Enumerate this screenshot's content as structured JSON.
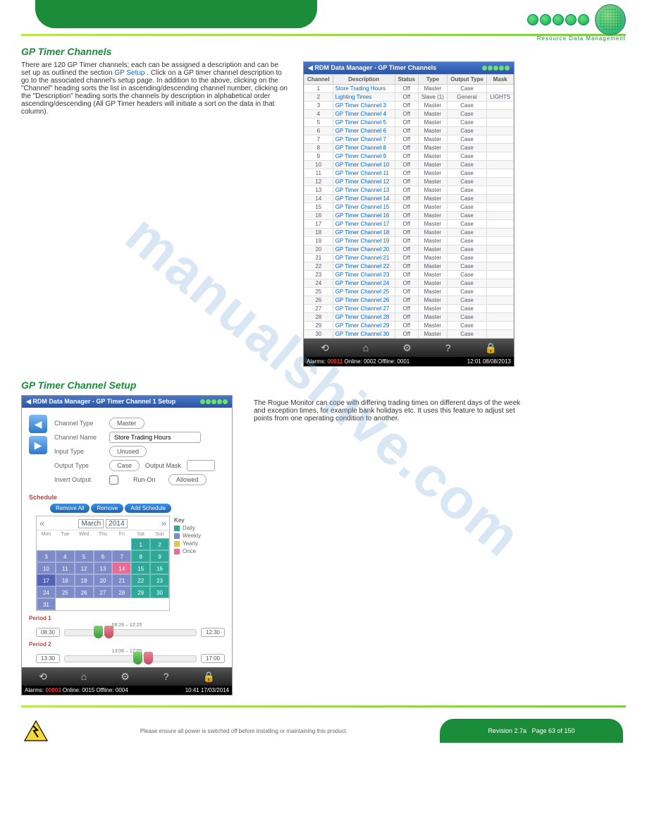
{
  "brand_tagline": "Resource Data Management",
  "section1_title": "GP Timer Channels",
  "section1_text_a": "There are 120 GP Timer channels; each can be assigned a description and can be set up as outlined the section ",
  "section1_link": "GP Setup",
  "section1_text_b": ". Click on a GP timer channel description to go to the associated channel's setup page. In addition to the above, clicking on the \"Channel\" heading sorts the list in ascending/descending channel number, clicking on the \"Description\" heading sorts the channels by description in alphabetical order ascending/descending (All GP Timer headers will initiate a sort on the data in that column).",
  "section2_title": "GP Timer Channel Setup",
  "section2_text": "The Rogue Monitor can cope with differing trading times on different days of the week and exception times, for example bank holidays etc. It uses this feature to adjust set points from one operating condition to another.",
  "table_app_title": "RDM Data Manager - GP Timer Channels",
  "table_headers": {
    "c1": "Channel",
    "c2": "Description",
    "c3": "Status",
    "c4": "Type",
    "c5": "Output Type",
    "c6": "Mask"
  },
  "table_rows": [
    {
      "ch": "1",
      "desc": "Store Trading Hours",
      "status": "Off",
      "type": "Master",
      "otype": "Case",
      "mask": ""
    },
    {
      "ch": "2",
      "desc": "Lighting Times",
      "status": "Off",
      "type": "Slave (1)",
      "otype": "General",
      "mask": "LIGHTS"
    },
    {
      "ch": "3",
      "desc": "GP Timer Channel 3",
      "status": "Off",
      "type": "Master",
      "otype": "Case",
      "mask": ""
    },
    {
      "ch": "4",
      "desc": "GP Timer Channel 4",
      "status": "Off",
      "type": "Master",
      "otype": "Case",
      "mask": ""
    },
    {
      "ch": "5",
      "desc": "GP Timer Channel 5",
      "status": "Off",
      "type": "Master",
      "otype": "Case",
      "mask": ""
    },
    {
      "ch": "6",
      "desc": "GP Timer Channel 6",
      "status": "Off",
      "type": "Master",
      "otype": "Case",
      "mask": ""
    },
    {
      "ch": "7",
      "desc": "GP Timer Channel 7",
      "status": "Off",
      "type": "Master",
      "otype": "Case",
      "mask": ""
    },
    {
      "ch": "8",
      "desc": "GP Timer Channel 8",
      "status": "Off",
      "type": "Master",
      "otype": "Case",
      "mask": ""
    },
    {
      "ch": "9",
      "desc": "GP Timer Channel 9",
      "status": "Off",
      "type": "Master",
      "otype": "Case",
      "mask": ""
    },
    {
      "ch": "10",
      "desc": "GP Timer Channel 10",
      "status": "Off",
      "type": "Master",
      "otype": "Case",
      "mask": ""
    },
    {
      "ch": "11",
      "desc": "GP Timer Channel 11",
      "status": "Off",
      "type": "Master",
      "otype": "Case",
      "mask": ""
    },
    {
      "ch": "12",
      "desc": "GP Timer Channel 12",
      "status": "Off",
      "type": "Master",
      "otype": "Case",
      "mask": ""
    },
    {
      "ch": "13",
      "desc": "GP Timer Channel 13",
      "status": "Off",
      "type": "Master",
      "otype": "Case",
      "mask": ""
    },
    {
      "ch": "14",
      "desc": "GP Timer Channel 14",
      "status": "Off",
      "type": "Master",
      "otype": "Case",
      "mask": ""
    },
    {
      "ch": "15",
      "desc": "GP Timer Channel 15",
      "status": "Off",
      "type": "Master",
      "otype": "Case",
      "mask": ""
    },
    {
      "ch": "16",
      "desc": "GP Timer Channel 16",
      "status": "Off",
      "type": "Master",
      "otype": "Case",
      "mask": ""
    },
    {
      "ch": "17",
      "desc": "GP Timer Channel 17",
      "status": "Off",
      "type": "Master",
      "otype": "Case",
      "mask": ""
    },
    {
      "ch": "18",
      "desc": "GP Timer Channel 18",
      "status": "Off",
      "type": "Master",
      "otype": "Case",
      "mask": ""
    },
    {
      "ch": "19",
      "desc": "GP Timer Channel 19",
      "status": "Off",
      "type": "Master",
      "otype": "Case",
      "mask": ""
    },
    {
      "ch": "20",
      "desc": "GP Timer Channel 20",
      "status": "Off",
      "type": "Master",
      "otype": "Case",
      "mask": ""
    },
    {
      "ch": "21",
      "desc": "GP Timer Channel 21",
      "status": "Off",
      "type": "Master",
      "otype": "Case",
      "mask": ""
    },
    {
      "ch": "22",
      "desc": "GP Timer Channel 22",
      "status": "Off",
      "type": "Master",
      "otype": "Case",
      "mask": ""
    },
    {
      "ch": "23",
      "desc": "GP Timer Channel 23",
      "status": "Off",
      "type": "Master",
      "otype": "Case",
      "mask": ""
    },
    {
      "ch": "24",
      "desc": "GP Timer Channel 24",
      "status": "Off",
      "type": "Master",
      "otype": "Case",
      "mask": ""
    },
    {
      "ch": "25",
      "desc": "GP Timer Channel 25",
      "status": "Off",
      "type": "Master",
      "otype": "Case",
      "mask": ""
    },
    {
      "ch": "26",
      "desc": "GP Timer Channel 26",
      "status": "Off",
      "type": "Master",
      "otype": "Case",
      "mask": ""
    },
    {
      "ch": "27",
      "desc": "GP Timer Channel 27",
      "status": "Off",
      "type": "Master",
      "otype": "Case",
      "mask": ""
    },
    {
      "ch": "28",
      "desc": "GP Timer Channel 28",
      "status": "Off",
      "type": "Master",
      "otype": "Case",
      "mask": ""
    },
    {
      "ch": "29",
      "desc": "GP Timer Channel 29",
      "status": "Off",
      "type": "Master",
      "otype": "Case",
      "mask": ""
    },
    {
      "ch": "30",
      "desc": "GP Timer Channel 30",
      "status": "Off",
      "type": "Master",
      "otype": "Case",
      "mask": ""
    }
  ],
  "status_bar1": {
    "alarms_label": "Alarms:",
    "alarms": "00011",
    "online": "Online: 0002",
    "offline": "Offline: 0001",
    "clock": "12:01 08/08/2013"
  },
  "setup_app_title": "RDM Data Manager - GP Timer Channel 1 Setup",
  "setup": {
    "channel_type_label": "Channel Type",
    "channel_type": "Master",
    "channel_name_label": "Channel Name",
    "channel_name": "Store Trading Hours",
    "input_type_label": "Input Type",
    "input_type": "Unused",
    "output_type_label": "Output Type",
    "output_type": "Case",
    "output_mask_label": "Output Mask",
    "output_mask": "",
    "invert_label": "Invert Output",
    "runon_label": "Run-On",
    "runon": "Allowed",
    "schedule_label": "Schedule",
    "btn_remove_all": "Remove All",
    "btn_remove": "Remove",
    "btn_add": "Add Schedule",
    "month": "March",
    "year": "2014",
    "dow": [
      "Mon",
      "Tue",
      "Wed",
      "Thu",
      "Fri",
      "Sat",
      "Sun"
    ],
    "key_label": "Key",
    "legend": {
      "daily": "Daily",
      "weekly": "Weekly",
      "yearly": "Yearly",
      "once": "Once"
    },
    "period1_label": "Period 1",
    "period2_label": "Period 2",
    "p1_range": "08:26 – 12:25",
    "p1_start": "08:30",
    "p1_end": "12:30",
    "p2_range": "13:06 – 17:05",
    "p2_start": "13:30",
    "p2_end": "17:00"
  },
  "status_bar2": {
    "alarms_label": "Alarms:",
    "alarms": "00003",
    "online": "Online: 0015",
    "offline": "Offline: 0004",
    "clock": "10:41 17/03/2014"
  },
  "calendar_cells": [
    {
      "v": "",
      "c": "c-empty"
    },
    {
      "v": "",
      "c": "c-empty"
    },
    {
      "v": "",
      "c": "c-empty"
    },
    {
      "v": "",
      "c": "c-empty"
    },
    {
      "v": "",
      "c": "c-empty"
    },
    {
      "v": "1",
      "c": "c-green"
    },
    {
      "v": "2",
      "c": "c-green"
    },
    {
      "v": "3",
      "c": "c-blue"
    },
    {
      "v": "4",
      "c": "c-blue"
    },
    {
      "v": "5",
      "c": "c-blue"
    },
    {
      "v": "6",
      "c": "c-blue"
    },
    {
      "v": "7",
      "c": "c-blue"
    },
    {
      "v": "8",
      "c": "c-green"
    },
    {
      "v": "9",
      "c": "c-green"
    },
    {
      "v": "10",
      "c": "c-blue"
    },
    {
      "v": "11",
      "c": "c-blue"
    },
    {
      "v": "12",
      "c": "c-blue"
    },
    {
      "v": "13",
      "c": "c-blue"
    },
    {
      "v": "14",
      "c": "c-pink"
    },
    {
      "v": "15",
      "c": "c-green"
    },
    {
      "v": "16",
      "c": "c-green"
    },
    {
      "v": "17",
      "c": "c-blue-d"
    },
    {
      "v": "18",
      "c": "c-blue"
    },
    {
      "v": "19",
      "c": "c-blue"
    },
    {
      "v": "20",
      "c": "c-blue"
    },
    {
      "v": "21",
      "c": "c-blue"
    },
    {
      "v": "22",
      "c": "c-green"
    },
    {
      "v": "23",
      "c": "c-green"
    },
    {
      "v": "24",
      "c": "c-blue"
    },
    {
      "v": "25",
      "c": "c-blue"
    },
    {
      "v": "26",
      "c": "c-blue"
    },
    {
      "v": "27",
      "c": "c-blue"
    },
    {
      "v": "28",
      "c": "c-blue"
    },
    {
      "v": "29",
      "c": "c-green"
    },
    {
      "v": "30",
      "c": "c-green"
    },
    {
      "v": "31",
      "c": "c-blue"
    },
    {
      "v": "",
      "c": "c-empty"
    },
    {
      "v": "",
      "c": "c-empty"
    },
    {
      "v": "",
      "c": "c-empty"
    },
    {
      "v": "",
      "c": "c-empty"
    },
    {
      "v": "",
      "c": "c-empty"
    },
    {
      "v": "",
      "c": "c-empty"
    }
  ],
  "footer": {
    "warn": "Please ensure all power is switched off before installing or maintaining this product.",
    "rev": "Revision 2.7a",
    "page": "Page 63 of 150"
  },
  "watermark": "manualshive.com"
}
